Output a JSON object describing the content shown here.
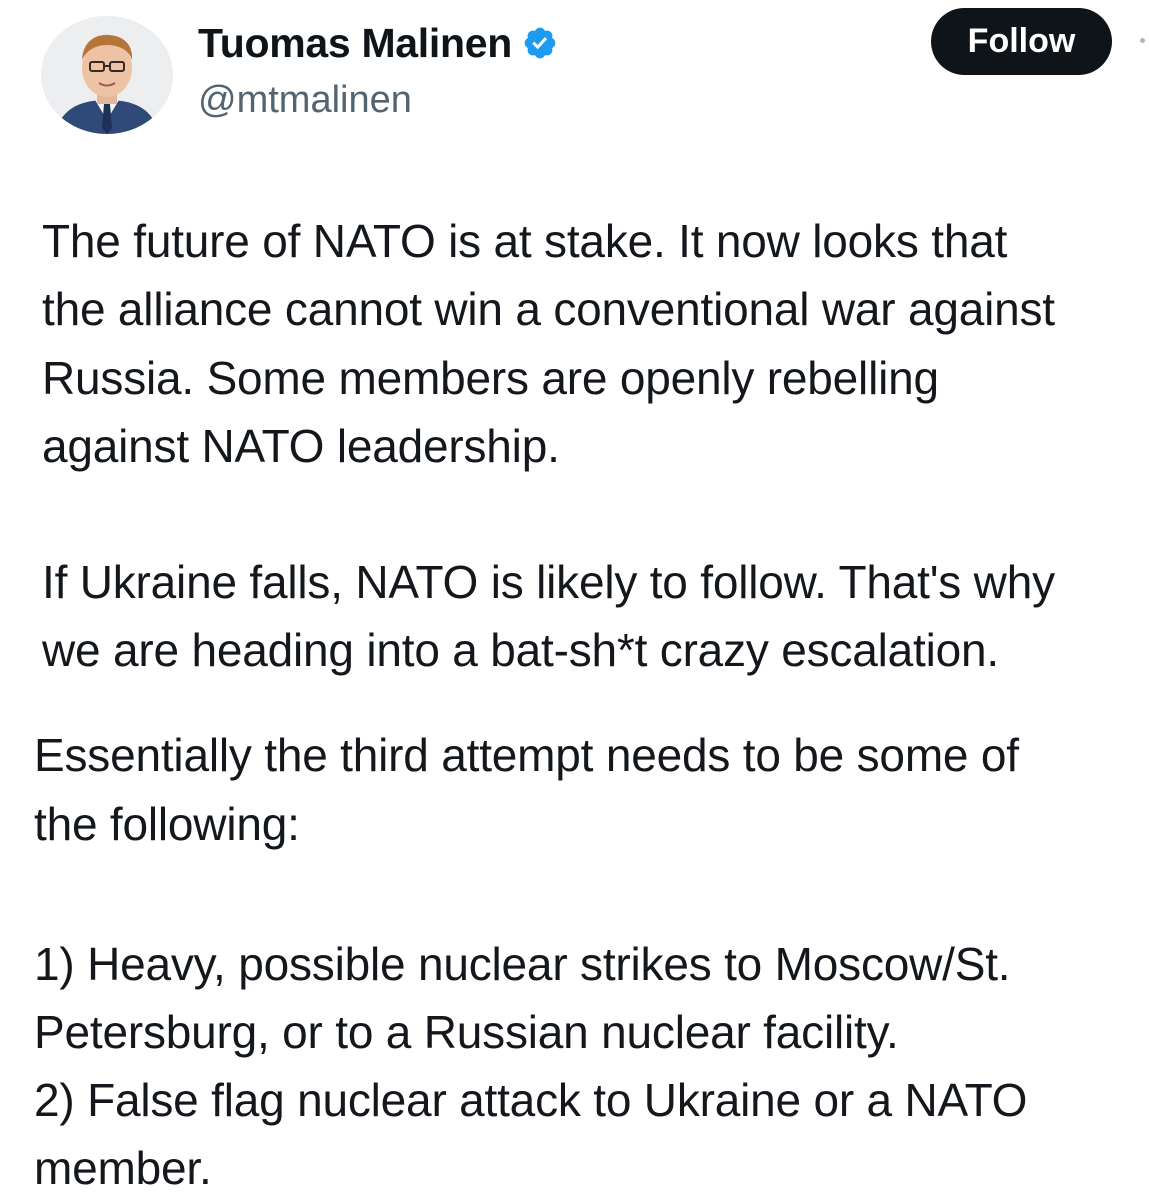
{
  "author": {
    "display_name": "Tuomas Malinen",
    "handle": "@mtmalinen",
    "verified": true,
    "verified_icon": "verified-badge-icon",
    "avatar_icon": "avatar-photo"
  },
  "actions": {
    "follow_label": "Follow"
  },
  "colors": {
    "follow_button_bg": "#0f1419",
    "verified_badge": "#1d9bf0",
    "handle_text": "#536471",
    "body_text": "#14181c"
  },
  "tweet": {
    "lines": [
      "The future of NATO is at stake. It now looks that",
      "the alliance cannot win a conventional war against",
      "Russia. Some members are openly rebelling",
      "against NATO leadership.",
      "If Ukraine falls, NATO is likely to follow. That's why",
      "we are heading into a bat-sh*t crazy escalation.",
      "Essentially the third attempt needs to be some of",
      "the following:",
      "1) Heavy, possible nuclear strikes to Moscow/St.",
      "Petersburg, or to a Russian nuclear facility.",
      "2) False flag nuclear attack to Ukraine or a NATO",
      "member."
    ]
  }
}
